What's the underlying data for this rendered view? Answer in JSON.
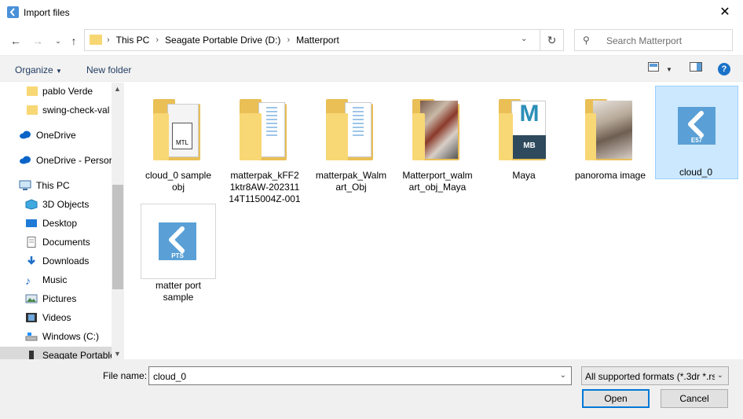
{
  "window": {
    "title": "Import files"
  },
  "nav": {
    "crumbs": [
      "This PC",
      "Seagate Portable Drive (D:)",
      "Matterport"
    ],
    "search_placeholder": "Search Matterport"
  },
  "toolbar": {
    "organize_label": "Organize",
    "new_folder_label": "New folder"
  },
  "sidebar": {
    "items": [
      {
        "label": "pablo Verde",
        "icon": "folder-icon"
      },
      {
        "label": "swing-check-val",
        "icon": "folder-icon"
      },
      {
        "label": "OneDrive",
        "icon": "cloud-icon"
      },
      {
        "label": "OneDrive - Persor",
        "icon": "cloud-icon"
      },
      {
        "label": "This PC",
        "icon": "computer-icon"
      },
      {
        "label": "3D Objects",
        "icon": "cube-icon"
      },
      {
        "label": "Desktop",
        "icon": "desktop-icon"
      },
      {
        "label": "Documents",
        "icon": "document-icon"
      },
      {
        "label": "Downloads",
        "icon": "download-icon"
      },
      {
        "label": "Music",
        "icon": "music-icon"
      },
      {
        "label": "Pictures",
        "icon": "pictures-icon"
      },
      {
        "label": "Videos",
        "icon": "video-icon"
      },
      {
        "label": "Windows (C:)",
        "icon": "drive-icon"
      },
      {
        "label": "Seagate Portable",
        "icon": "drive-icon"
      }
    ]
  },
  "files": [
    {
      "label": "cloud_0 sample obj",
      "kind": "folder-mtl",
      "badge": "MTL"
    },
    {
      "label": "matterpak_kFF21ktr8AW-20231114T115004Z-001",
      "kind": "folder-doc"
    },
    {
      "label": "matterpak_Walmart_Obj",
      "kind": "folder-doc"
    },
    {
      "label": "Matterport_walmart_obj_Maya",
      "kind": "folder-image"
    },
    {
      "label": "Maya",
      "kind": "folder-maya",
      "badge": "MB",
      "letter": "M"
    },
    {
      "label": "panoroma image",
      "kind": "folder-image"
    },
    {
      "label": "cloud_0",
      "kind": "file-e57",
      "badge": "E57"
    },
    {
      "label": "matter port sample",
      "kind": "file-pts",
      "badge": "PTS"
    }
  ],
  "bottom": {
    "filename_label": "File name:",
    "filename_value": "cloud_0",
    "filter_value": "All supported formats (*.3dr *.rs",
    "open_label": "Open",
    "cancel_label": "Cancel"
  },
  "colors": {
    "accent": "#0078d7",
    "selection": "#cce8ff",
    "folder": "#f8d775"
  }
}
